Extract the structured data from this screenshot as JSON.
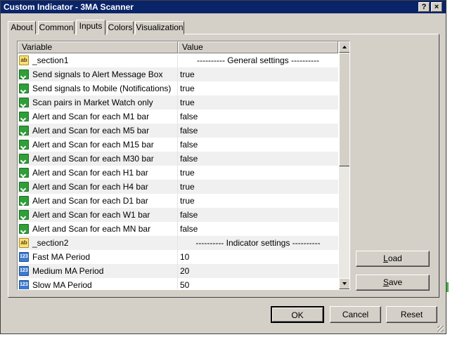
{
  "window": {
    "title": "Custom Indicator - 3MA Scanner",
    "help_label": "?",
    "close_label": "×"
  },
  "tabs": [
    {
      "label": "About"
    },
    {
      "label": "Common"
    },
    {
      "label": "Inputs"
    },
    {
      "label": "Colors"
    },
    {
      "label": "Visualization"
    }
  ],
  "active_tab": "Inputs",
  "table": {
    "headers": {
      "variable": "Variable",
      "value": "Value"
    },
    "rows": [
      {
        "icon": "text-icon",
        "variable": "_section1",
        "value": "---------- General settings ----------",
        "center": true
      },
      {
        "icon": "bool-icon",
        "variable": "Send signals to Alert Message Box",
        "value": "true"
      },
      {
        "icon": "bool-icon",
        "variable": "Send signals to Mobile (Notifications)",
        "value": "true"
      },
      {
        "icon": "bool-icon",
        "variable": "Scan pairs in Market Watch only",
        "value": "true"
      },
      {
        "icon": "bool-icon",
        "variable": "Alert and Scan for each M1 bar",
        "value": "false"
      },
      {
        "icon": "bool-icon",
        "variable": "Alert and Scan for each M5 bar",
        "value": "false"
      },
      {
        "icon": "bool-icon",
        "variable": "Alert and Scan for each M15 bar",
        "value": "false"
      },
      {
        "icon": "bool-icon",
        "variable": "Alert and Scan for each M30 bar",
        "value": "false"
      },
      {
        "icon": "bool-icon",
        "variable": "Alert and Scan for each H1 bar",
        "value": "true"
      },
      {
        "icon": "bool-icon",
        "variable": "Alert and Scan for each H4 bar",
        "value": "true"
      },
      {
        "icon": "bool-icon",
        "variable": "Alert and Scan for each D1 bar",
        "value": "true"
      },
      {
        "icon": "bool-icon",
        "variable": "Alert and Scan for each W1 bar",
        "value": "false"
      },
      {
        "icon": "bool-icon",
        "variable": "Alert and Scan for each MN bar",
        "value": "false"
      },
      {
        "icon": "text-icon",
        "variable": "_section2",
        "value": "---------- Indicator settings ----------",
        "center": true
      },
      {
        "icon": "number-icon",
        "variable": "Fast MA Period",
        "value": "10"
      },
      {
        "icon": "number-icon",
        "variable": "Medium MA Period",
        "value": "20"
      },
      {
        "icon": "number-icon",
        "variable": "Slow MA Period",
        "value": "50"
      }
    ]
  },
  "icons": {
    "text_glyph": "ab",
    "number_glyph": "123"
  },
  "buttons": {
    "load_mnemonic": "L",
    "load_rest": "oad",
    "save_mnemonic": "S",
    "save_rest": "ave",
    "ok": "OK",
    "cancel": "Cancel",
    "reset": "Reset"
  }
}
